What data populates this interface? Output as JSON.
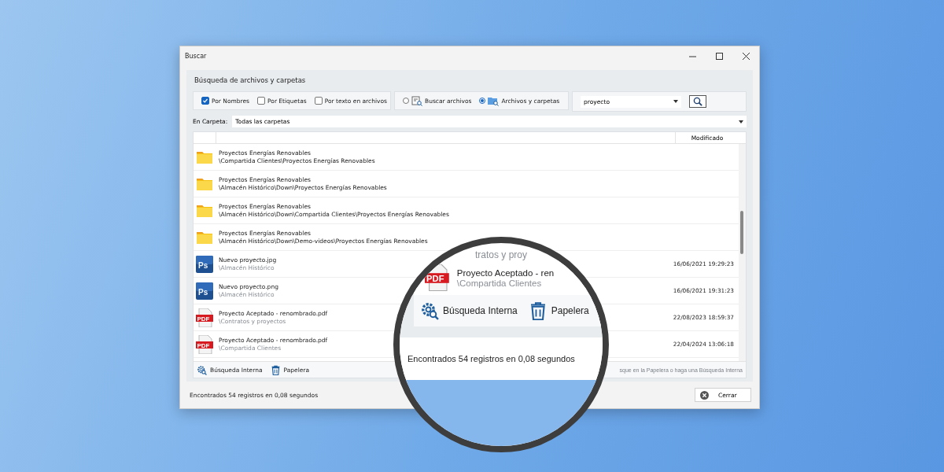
{
  "window": {
    "title": "Buscar"
  },
  "panel": {
    "title": "Búsqueda de archivos y carpetas"
  },
  "filters": [
    {
      "label": "Por Nombres",
      "checked": true
    },
    {
      "label": "Por Etiquetas",
      "checked": false
    },
    {
      "label": "Por texto en archivos",
      "checked": false
    }
  ],
  "modes": [
    {
      "label": "Buscar archivos",
      "selected": false,
      "kind": "files"
    },
    {
      "label": "Archivos y carpetas",
      "selected": true,
      "kind": "folders"
    }
  ],
  "search": {
    "value": "proyecto"
  },
  "folder": {
    "label": "En Carpeta:",
    "value": "Todas las carpetas"
  },
  "table": {
    "columns": [
      "Modificado"
    ],
    "rows": [
      {
        "kind": "folder",
        "name": "Proyectos Energías Renovables",
        "path": "\\Compartida Clientes\\Proyectos Energías Renovables"
      },
      {
        "kind": "folder",
        "name": "Proyectos Energías Renovables",
        "path": "\\Almacén Histórico\\Down\\Proyectos Energías Renovables"
      },
      {
        "kind": "folder",
        "name": "Proyectos Energías Renovables",
        "path": "\\Almacén Histórico\\Down\\Compartida Clientes\\Proyectos Energías Renovables"
      },
      {
        "kind": "folder",
        "name": "Proyectos Energías Renovables",
        "path": "\\Almacén Histórico\\Down\\Demo-videos\\Proyectos Energías Renovables"
      },
      {
        "kind": "ps",
        "badge": "Ps",
        "name": "Nuevo proyecto.jpg",
        "path": "\\Almacén Histórico",
        "modified": "16/06/2021 19:29:23"
      },
      {
        "kind": "ps",
        "badge": "Ps",
        "name": "Nuevo proyecto.png",
        "path": "\\Almacén Histórico",
        "modified": "16/06/2021 19:31:23"
      },
      {
        "kind": "pdf",
        "badge": "PDF",
        "name": "Proyecto Aceptado - renombrado.pdf",
        "path": "\\Contratos y proyectos",
        "modified": "22/08/2023 18:59:37"
      },
      {
        "kind": "pdf",
        "badge": "PDF",
        "name": "Proyecto Aceptado - renombrado.pdf",
        "path": "\\Compartida Clientes",
        "modified": "22/04/2024 13:06:18"
      }
    ]
  },
  "tools": [
    {
      "label": "Búsqueda Interna",
      "kind": "internal"
    },
    {
      "label": "Papelera",
      "kind": "trash"
    }
  ],
  "hint": "sque en la Papelera o haga una Búsqueda Interna",
  "status_bar": {
    "text": "Encontrados 54 registros en 0,08 segundos"
  },
  "close_button": {
    "label": "Cerrar"
  },
  "magnifier": {
    "partial": "tratos y proy",
    "row": {
      "kind": "pdf",
      "badge": "PDF",
      "name": "Proyecto Aceptado - ren",
      "path": "\\Compartida Clientes"
    },
    "tools": [
      {
        "label": "Búsqueda Interna",
        "kind": "internal"
      },
      {
        "label": "Papelera",
        "kind": "trash"
      }
    ],
    "status": "Encontrados 54 registros en 0,08 segundos"
  }
}
